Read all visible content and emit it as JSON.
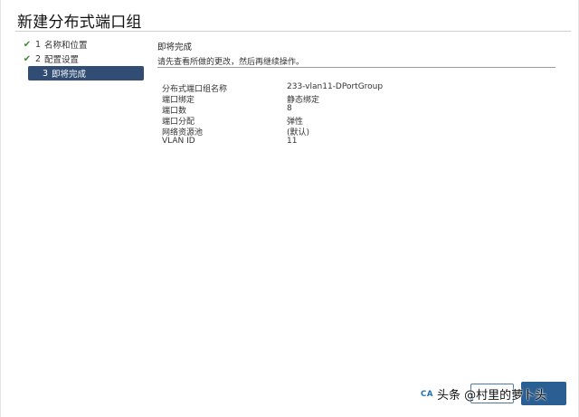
{
  "dialog": {
    "title": "新建分布式端口组"
  },
  "steps": [
    {
      "num": "1",
      "label": "名称和位置",
      "done": true
    },
    {
      "num": "2",
      "label": "配置设置",
      "done": true
    },
    {
      "num": "3",
      "label": "即将完成",
      "done": false,
      "active": true
    }
  ],
  "content": {
    "section_title": "即将完成",
    "section_desc": "请先查看所做的更改，然后再继续操作。",
    "rows": [
      {
        "key": "分布式端口组名称",
        "value": "233-vlan11-DPortGroup"
      },
      {
        "key": "端口绑定",
        "value": "静态绑定"
      },
      {
        "key": "端口数",
        "value": "8"
      },
      {
        "key": "端口分配",
        "value": "弹性"
      },
      {
        "key": "网络资源池",
        "value": "(默认)"
      },
      {
        "key": "VLAN ID",
        "value": "11"
      }
    ]
  },
  "footer": {
    "cancel_label": "CA"
  },
  "watermark": "头条 @村里的萝卜头",
  "colors": {
    "active_step_bg": "#314d74",
    "check": "#3b8d2e",
    "primary_button": "#2b5f93",
    "link": "#1f6fb0"
  }
}
